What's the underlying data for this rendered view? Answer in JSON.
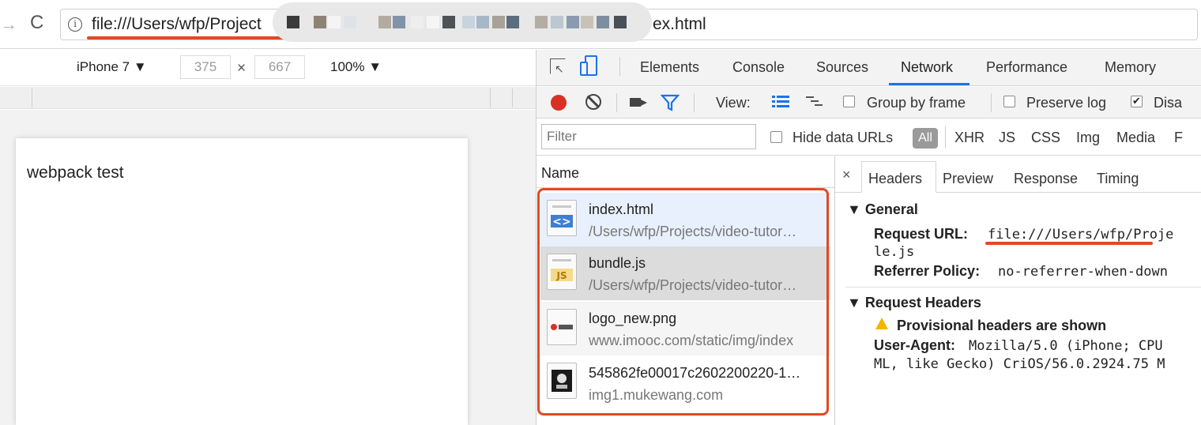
{
  "browser": {
    "url_prefix": "file:///Users/wfp/Project",
    "url_suffix": "ex.html",
    "forward_icon": "arrow-right",
    "reload_icon": "reload",
    "info_icon": "info"
  },
  "device_toolbar": {
    "device": "iPhone 7 ▼",
    "width": "375",
    "times": "×",
    "height": "667",
    "zoom": "100% ▼"
  },
  "page": {
    "content_text": "webpack test"
  },
  "devtools": {
    "tabs": [
      "Elements",
      "Console",
      "Sources",
      "Network",
      "Performance",
      "Memory"
    ],
    "active_tab": "Network",
    "controls": {
      "view_label": "View:",
      "group_by_frame": "Group by frame",
      "preserve_log": "Preserve log",
      "disable_cache": "Disa"
    },
    "filter": {
      "placeholder": "Filter",
      "hide_data_urls": "Hide data URLs",
      "all": "All",
      "types": [
        "XHR",
        "JS",
        "CSS",
        "Img",
        "Media",
        "F"
      ]
    },
    "requests": {
      "header": "Name",
      "rows": [
        {
          "name": "index.html",
          "path": "/Users/wfp/Projects/video-tutor…",
          "icon": "html-file"
        },
        {
          "name": "bundle.js",
          "path": "/Users/wfp/Projects/video-tutor…",
          "icon": "js-file"
        },
        {
          "name": "logo_new.png",
          "path": "www.imooc.com/static/img/index",
          "icon": "image-file"
        },
        {
          "name": "545862fe00017c2602200220-1…",
          "path": "img1.mukewang.com",
          "icon": "image-file"
        }
      ]
    },
    "detail": {
      "close": "×",
      "tabs": [
        "Headers",
        "Preview",
        "Response",
        "Timing"
      ],
      "general_title": "▼ General",
      "request_url_key": "Request URL:",
      "request_url_value": "file:///Users/wfp/Proje",
      "request_url_cont": "le.js",
      "referrer_key": "Referrer Policy:",
      "referrer_value": "no-referrer-when-down",
      "req_headers_title": "▼ Request Headers",
      "provisional": "Provisional headers are shown",
      "ua_key": "User-Agent:",
      "ua_value": "Mozilla/5.0 (iPhone; CPU",
      "ua_cont": "ML, like Gecko) CriOS/56.0.2924.75 M"
    }
  },
  "colors": {
    "annotation": "#e04a24",
    "accent": "#1a73e8",
    "record": "#d93025"
  }
}
